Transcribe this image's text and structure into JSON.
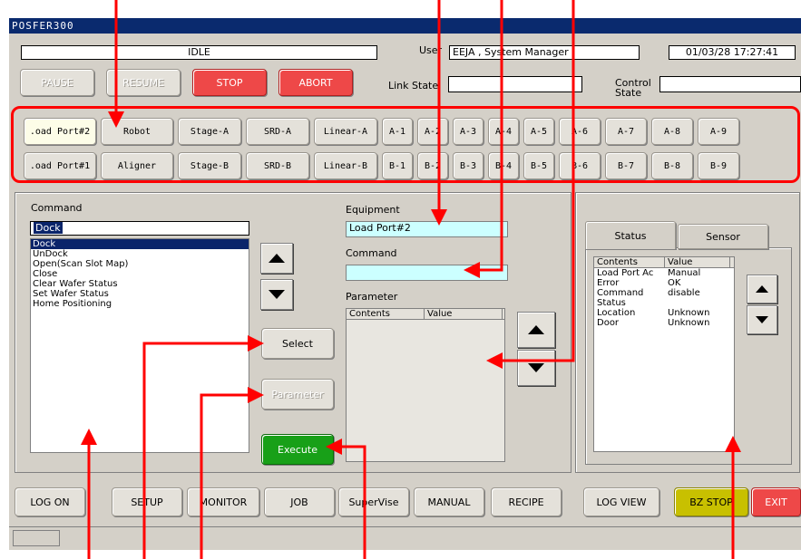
{
  "app_title": "POSFER300",
  "header": {
    "status_value": "IDLE",
    "user_label": "User",
    "user_value": "EEJA , System Manager",
    "datetime": "01/03/28 17:27:41",
    "link_state_label": "Link State",
    "link_state_value": "",
    "control_state_label": "Control State",
    "control_state_value": ""
  },
  "control_buttons": {
    "pause": "PAUSE",
    "resume": "RESUME",
    "stop": "STOP",
    "abort": "ABORT"
  },
  "unit_row1": [
    ".oad Port#2",
    "Robot",
    "Stage-A",
    "SRD-A",
    "Linear-A",
    "A-1",
    "A-2",
    "A-3",
    "A-4",
    "A-5",
    "A-6",
    "A-7",
    "A-8",
    "A-9"
  ],
  "unit_row2": [
    ".oad Port#1",
    "Aligner",
    "Stage-B",
    "SRD-B",
    "Linear-B",
    "B-1",
    "B-2",
    "B-3",
    "B-4",
    "B-5",
    "B-6",
    "B-7",
    "B-8",
    "B-9"
  ],
  "command_panel": {
    "title": "Command",
    "selected_value": "Dock",
    "items": [
      "Dock",
      "UnDock",
      "Open(Scan Slot Map)",
      "Close",
      "Clear Wafer Status",
      "Set Wafer Status",
      "Home Positioning"
    ],
    "select_button": "Select",
    "parameter_button": "Parameter",
    "execute_button": "Execute"
  },
  "equipment_panel": {
    "equipment_label": "Equipment",
    "equipment_value": "Load Port#2",
    "command_label": "Command",
    "command_value": "",
    "parameter_label": "Parameter",
    "parameter_columns": [
      "Contents",
      "Value"
    ]
  },
  "status_panel": {
    "tabs": [
      "Status",
      "Sensor"
    ],
    "columns": [
      "Contents",
      "Value"
    ],
    "rows": [
      {
        "contents": "Load Port Ac",
        "value": "Manual"
      },
      {
        "contents": "Error",
        "value": "OK"
      },
      {
        "contents": "Command",
        "value": "disable"
      },
      {
        "contents": "Status",
        "value": ""
      },
      {
        "contents": "Location",
        "value": "Unknown"
      },
      {
        "contents": "Door",
        "value": "Unknown"
      }
    ]
  },
  "bottom_nav": [
    "LOG ON",
    "SETUP",
    "MONITOR",
    "JOB",
    "SuperVise",
    "MANUAL",
    "RECIPE",
    "LOG VIEW",
    "BZ STOP",
    "EXIT"
  ],
  "colors": {
    "title_bar": "#0a2a6e",
    "window_bg": "#d4d0c8",
    "stop_abort": "#ee4848",
    "execute": "#18a018",
    "bz_stop": "#c8c000",
    "highlight_field": "#ccffff",
    "list_selection": "#0a246a",
    "annotation_red": "#ff0000"
  }
}
